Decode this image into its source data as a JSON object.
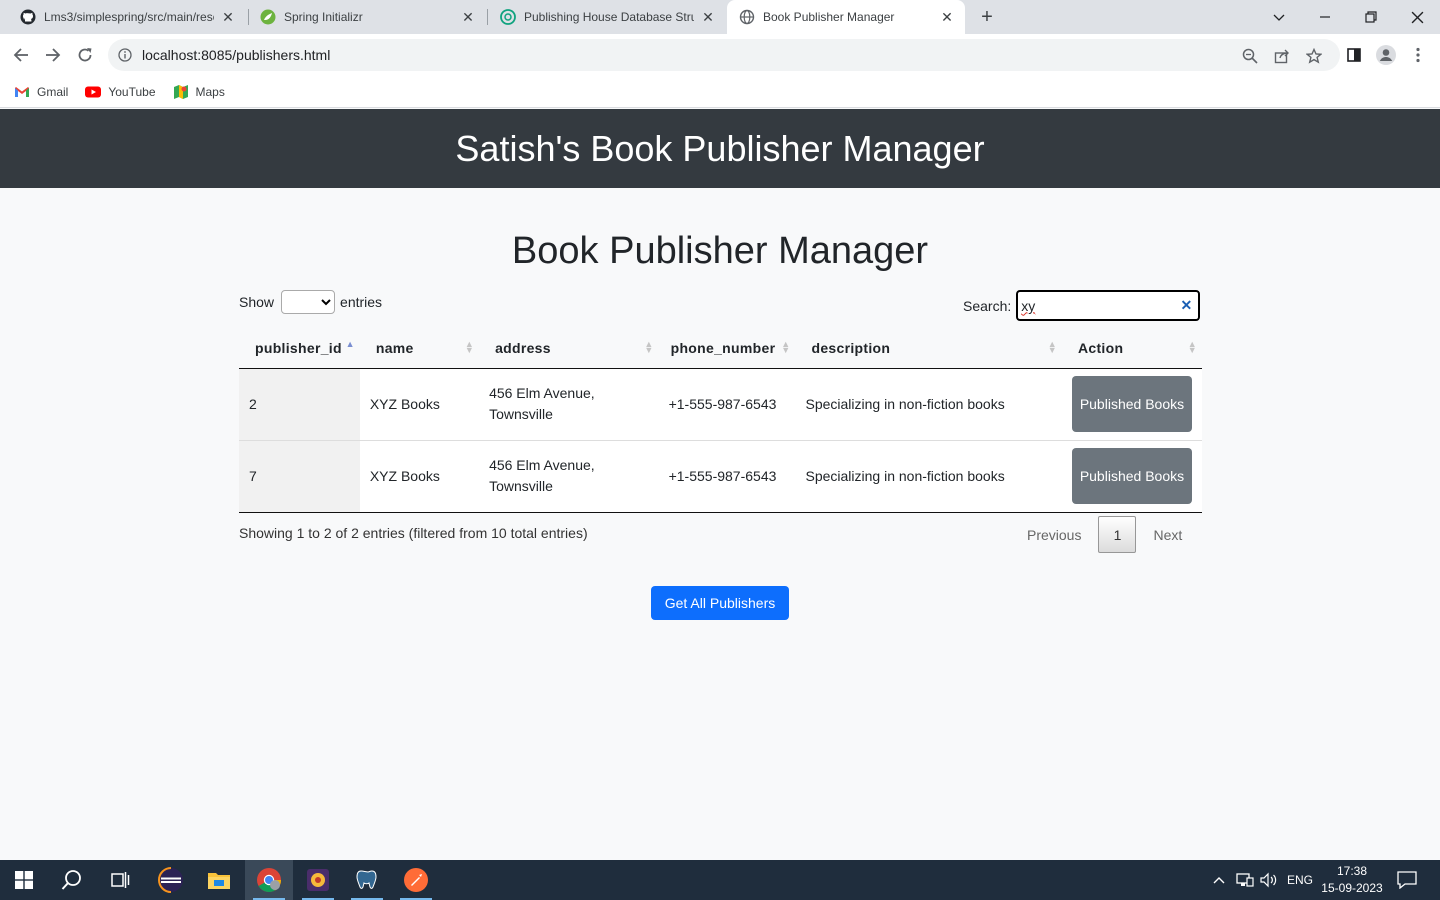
{
  "browser": {
    "tabs": [
      {
        "title": "Lms3/simplespring/src/main/resc",
        "icon": "github-icon"
      },
      {
        "title": "Spring Initializr",
        "icon": "spring-icon"
      },
      {
        "title": "Publishing House Database Struc",
        "icon": "chatgpt-icon"
      },
      {
        "title": "Book Publisher Manager",
        "icon": "globe-icon",
        "active": true
      }
    ],
    "url": "localhost:8085/publishers.html",
    "bookmarks": [
      {
        "label": "Gmail",
        "icon": "gmail-icon"
      },
      {
        "label": "YouTube",
        "icon": "youtube-icon"
      },
      {
        "label": "Maps",
        "icon": "maps-icon"
      }
    ]
  },
  "header": {
    "title": "Satish's Book Publisher Manager"
  },
  "main": {
    "title": "Book Publisher Manager",
    "show_label": "Show",
    "entries_label": "entries",
    "search_label": "Search:",
    "search_value": "xy",
    "columns": [
      "publisher_id",
      "name",
      "address",
      "phone_number",
      "description",
      "Action"
    ],
    "rows": [
      {
        "publisher_id": "2",
        "name": "XYZ Books",
        "address": "456 Elm Avenue, Townsville",
        "phone_number": "+1-555-987-6543",
        "description": "Specializing in non-fiction books",
        "action": "Published Books"
      },
      {
        "publisher_id": "7",
        "name": "XYZ Books",
        "address": "456 Elm Avenue, Townsville",
        "phone_number": "+1-555-987-6543",
        "description": "Specializing in non-fiction books",
        "action": "Published Books"
      }
    ],
    "info": "Showing 1 to 2 of 2 entries (filtered from 10 total entries)",
    "pager": {
      "previous": "Previous",
      "current": "1",
      "next": "Next"
    },
    "get_all_label": "Get All Publishers"
  },
  "taskbar": {
    "language": "ENG",
    "time": "17:38",
    "date": "15-09-2023"
  },
  "colors": {
    "header_bg": "#343a40",
    "primary": "#0d6efd",
    "secondary": "#6c757d",
    "taskbar": "#1f2d3d"
  }
}
